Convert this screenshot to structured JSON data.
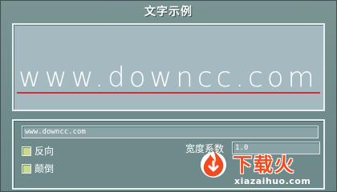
{
  "window": {
    "title": "文字示例"
  },
  "preview": {
    "text": "www.downcc.com",
    "baseline_color": "#c8323a"
  },
  "controls": {
    "input_value": "www.downcc.com",
    "reverse_label": "反向",
    "flip_label": "颠倒",
    "width_label": "宽度系数",
    "width_value": "1.0"
  },
  "watermark": {
    "brand": "下载火",
    "domain": "xiazaihuo.com"
  },
  "colors": {
    "window_bg": "#6f8a8a",
    "preview_bg": "#a4bac0",
    "checkbox": "#c9d98e",
    "brand": "#f04a1e"
  }
}
